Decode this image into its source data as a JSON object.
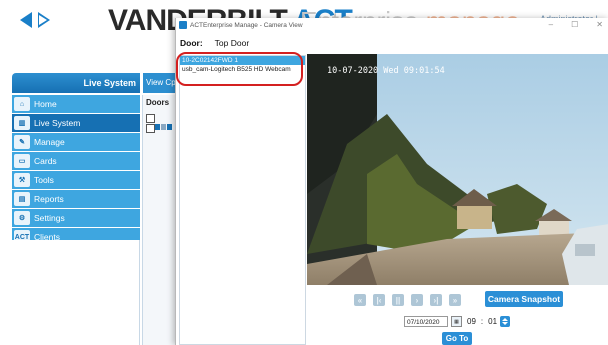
{
  "app": {
    "brand_main": "VANDERBILT",
    "brand_act": "ACT",
    "brand_tail_1": "Enterprise",
    "brand_tail_2": "manage",
    "top_right_text": "Administrator | Help",
    "section_title": "Live System",
    "view_tab": "View Cp",
    "menu": [
      {
        "label": "Home",
        "icon": "home-icon"
      },
      {
        "label": "Live System",
        "icon": "live-system-icon",
        "active": true
      },
      {
        "label": "Manage",
        "icon": "manage-icon"
      },
      {
        "label": "Cards",
        "icon": "cards-icon"
      },
      {
        "label": "Tools",
        "icon": "tools-icon"
      },
      {
        "label": "Reports",
        "icon": "reports-icon"
      },
      {
        "label": "Settings",
        "icon": "settings-icon"
      },
      {
        "label": "Clients",
        "icon": "clients-icon",
        "badge": "ACT"
      }
    ],
    "doors_panel_label": "Doors"
  },
  "dialog": {
    "title": "ACTEnterprise Manage - Camera View",
    "door_label": "Door:",
    "door_value": "Top Door",
    "cameras": [
      {
        "label": "10-2C02142FWD 1",
        "selected": true
      },
      {
        "label": "usb_cam-Logitech B525 HD Webcam",
        "selected": false
      }
    ],
    "timestamp": "10-07-2020 Wed 09:01:54",
    "snapshot_label": "Camera Snapshot",
    "date_value": "07/10/2020",
    "time_hour": "09",
    "time_minute": "01",
    "goto_label": "Go To"
  },
  "colors": {
    "accent_blue": "#2b8fd6",
    "menu_blue": "#3ea6e0",
    "active_blue": "#1670b3",
    "highlight_red": "#d42020"
  }
}
